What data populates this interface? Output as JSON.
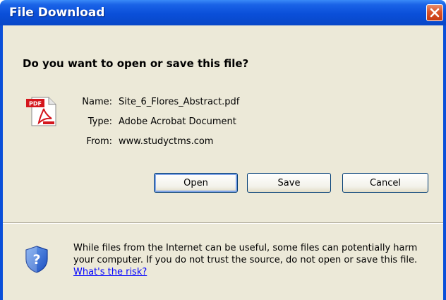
{
  "window": {
    "title": "File Download",
    "close_glyph": "✕"
  },
  "question": "Do you want to open or save this file?",
  "file": {
    "icon": "pdf-file-icon",
    "icon_badge": "PDF",
    "name_label": "Name:",
    "name_value": "Site_6_Flores_Abstract.pdf",
    "type_label": "Type:",
    "type_value": "Adobe Acrobat Document",
    "from_label": "From:",
    "from_value": "www.studyctms.com"
  },
  "buttons": {
    "open": "Open",
    "save": "Save",
    "cancel": "Cancel"
  },
  "warning": {
    "icon": "security-shield-icon",
    "text": "While files from the Internet can be useful, some files can potentially harm your computer. If you do not trust the source, do not open or save this file. ",
    "link": "What's the risk?"
  },
  "colors": {
    "titlebar": "#0a4fd9",
    "dialog_bg": "#ece9d8",
    "close_button": "#d9532a",
    "link": "#0000ff"
  }
}
